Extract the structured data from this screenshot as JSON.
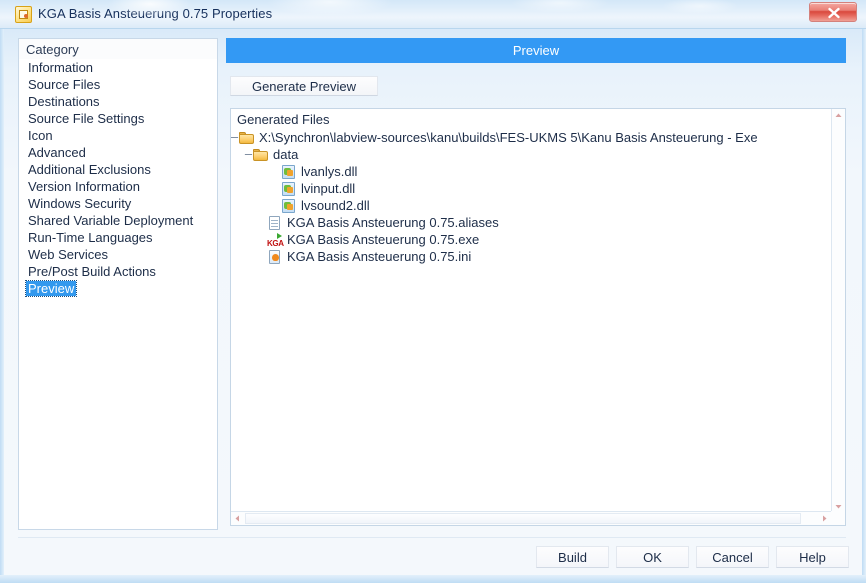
{
  "window": {
    "title": "KGA Basis Ansteuerung 0.75 Properties",
    "icon": "labview-app-icon",
    "close_label": "close-icon",
    "accent_color": "#3399f4",
    "close_color": "#d9483d"
  },
  "sidebar": {
    "header": "Category",
    "items": [
      {
        "label": "Information",
        "selected": false
      },
      {
        "label": "Source Files",
        "selected": false
      },
      {
        "label": "Destinations",
        "selected": false
      },
      {
        "label": "Source File Settings",
        "selected": false
      },
      {
        "label": "Icon",
        "selected": false
      },
      {
        "label": "Advanced",
        "selected": false
      },
      {
        "label": "Additional Exclusions",
        "selected": false
      },
      {
        "label": "Version Information",
        "selected": false
      },
      {
        "label": "Windows Security",
        "selected": false
      },
      {
        "label": "Shared Variable Deployment",
        "selected": false
      },
      {
        "label": "Run-Time Languages",
        "selected": false
      },
      {
        "label": "Web Services",
        "selected": false
      },
      {
        "label": "Pre/Post Build Actions",
        "selected": false
      },
      {
        "label": "Preview",
        "selected": true
      }
    ]
  },
  "main": {
    "banner_title": "Preview",
    "generate_button": "Generate Preview",
    "tree_title": "Generated Files",
    "tree": [
      {
        "label": "X:\\Synchron\\labview-sources\\kanu\\builds\\FES-UKMS 5\\Kanu Basis Ansteuerung - Exe",
        "icon": "folder-icon",
        "indent": 0,
        "expander": "–"
      },
      {
        "label": "data",
        "icon": "folder-icon",
        "indent": 1,
        "expander": "–"
      },
      {
        "label": "lvanlys.dll",
        "icon": "dll-icon",
        "indent": 3,
        "expander": ""
      },
      {
        "label": "lvinput.dll",
        "icon": "dll-icon",
        "indent": 3,
        "expander": ""
      },
      {
        "label": "lvsound2.dll",
        "icon": "dll-icon",
        "indent": 3,
        "expander": ""
      },
      {
        "label": "KGA Basis Ansteuerung 0.75.aliases",
        "icon": "document-icon",
        "indent": 2,
        "expander": ""
      },
      {
        "label": "KGA Basis Ansteuerung 0.75.exe",
        "icon": "exe-icon",
        "indent": 2,
        "expander": ""
      },
      {
        "label": "KGA Basis Ansteuerung 0.75.ini",
        "icon": "ini-icon",
        "indent": 2,
        "expander": ""
      }
    ]
  },
  "footer": {
    "buttons": [
      {
        "label": "Build"
      },
      {
        "label": "OK"
      },
      {
        "label": "Cancel"
      },
      {
        "label": "Help"
      }
    ]
  }
}
